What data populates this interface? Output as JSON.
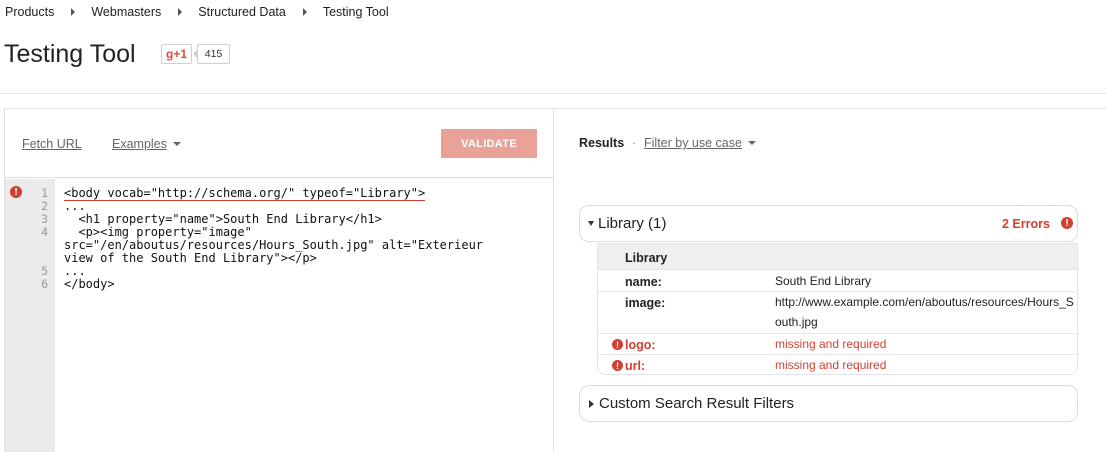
{
  "breadcrumb": [
    "Products",
    "Webmasters",
    "Structured Data",
    "Testing Tool"
  ],
  "title": "Testing Tool",
  "plusone": {
    "label": "+1",
    "count": "415"
  },
  "toolbar": {
    "fetch_url": "Fetch URL",
    "examples": "Examples",
    "validate": "VALIDATE"
  },
  "editor": {
    "error_marker": "!",
    "lines": [
      {
        "num": "1",
        "text": "<body vocab=\"http://schema.org/\" typeof=\"Library\">"
      },
      {
        "num": "2",
        "text": "..."
      },
      {
        "num": "3",
        "text": "  <h1 property=\"name\">South End Library</h1>"
      },
      {
        "num": "4",
        "text": "  <p><img property=\"image\"\nsrc=\"/en/aboutus/resources/Hours_South.jpg\" alt=\"Exterieur\nview of the South End Library\"></p>"
      },
      {
        "num": "5",
        "text": "..."
      },
      {
        "num": "6",
        "text": "</body>"
      }
    ]
  },
  "results": {
    "label": "Results",
    "separator": "·",
    "filter": "Filter by use case",
    "item": {
      "title": "Library (1)",
      "errors": "2 Errors",
      "type": "Library",
      "properties": [
        {
          "name": "name:",
          "value": "South End Library",
          "error": false
        },
        {
          "name": "image:",
          "value": "http://www.example.com/en/aboutus/resources/Hours_South.jpg",
          "error": false
        },
        {
          "name": "logo:",
          "value": "missing and required",
          "error": true
        },
        {
          "name": "url:",
          "value": "missing and required",
          "error": true
        }
      ]
    },
    "custom_filters": "Custom Search Result Filters"
  },
  "colors": {
    "error": "#d23f31",
    "validate_bg": "#e8a29a",
    "gutter": "#ebebeb"
  }
}
